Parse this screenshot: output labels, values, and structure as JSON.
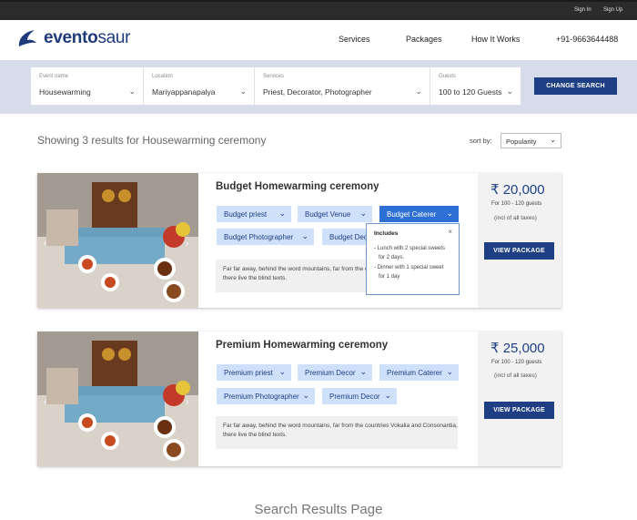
{
  "topbar": {
    "signin": "Sign In",
    "signup": "Sign Up"
  },
  "brand": {
    "logo_bold": "evento",
    "logo_light": "saur"
  },
  "nav": {
    "services": "Services",
    "packages": "Packages",
    "how": "How It Works",
    "phone": "+91-9663644488"
  },
  "search": {
    "fields": [
      {
        "label": "Event name",
        "value": "Housewarming"
      },
      {
        "label": "Location",
        "value": "Mariyappanapalya"
      },
      {
        "label": "Services",
        "value": "Priest, Decorator, Photographer"
      },
      {
        "label": "Guests",
        "value": "100 to 120 Guests"
      }
    ],
    "button": "CHANGE SEARCH"
  },
  "results": {
    "summary": "Showing 3 results for Housewarming ceremony",
    "sort_label": "sort by:",
    "sort_value": "Popularity"
  },
  "cards": [
    {
      "title": "Budget Homewarming ceremony",
      "chips": [
        "Budget priest",
        "Budget Venue",
        "Budget Caterer",
        "Budget Photographer",
        "Budget Decor"
      ],
      "desc": "Far far away, behind the word mountains, far from the countries Vokalia and Consonantia, there live the blind texts.",
      "price": "₹ 20,000",
      "guests": "For 100 - 120 guests",
      "tax": "(incl of all taxes)",
      "button": "VIEW PACKAGE"
    },
    {
      "title": "Premium Homewarming ceremony",
      "chips": [
        "Premium priest",
        "Premium Decor",
        "Premium Caterer",
        "Premium Photographer",
        "Premium Decor"
      ],
      "desc": "Far far away, behind the word mountains, far from the countries Vokalia and Consonantia, there live the blind texts.",
      "price": "₹ 25,000",
      "guests": "For 100 - 120 guests",
      "tax": "(incl of all taxes)",
      "button": "VIEW PACKAGE"
    }
  ],
  "popup": {
    "title": "Includes",
    "close": "×",
    "lines": [
      "- Lunch with 2 special sweets",
      "  for 2 days.",
      "- Dinner with 1 special sweet",
      "  for 1 day"
    ]
  },
  "caption": "Search Results Page",
  "icons": {
    "chevron": "chevron-down-icon",
    "close": "close-icon",
    "arrow_left": "arrow-left-icon",
    "arrow_right": "arrow-right-icon",
    "logo": "dino-logo-icon"
  },
  "colors": {
    "brand": "#1f3f85",
    "chip": "#cfe0fa",
    "chip_active": "#2e6fd6",
    "band": "#d6dcea"
  }
}
